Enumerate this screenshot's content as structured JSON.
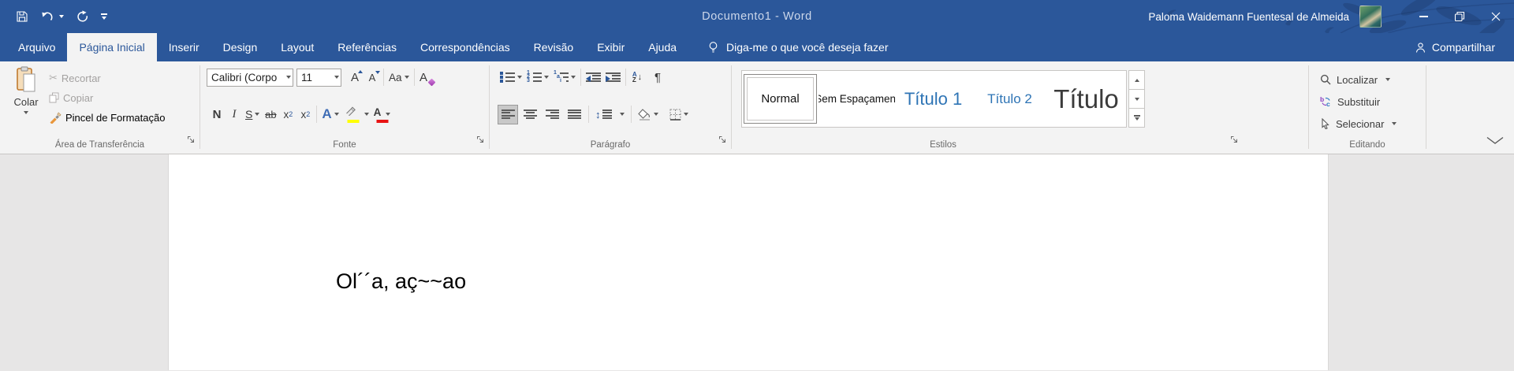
{
  "window": {
    "title": "Documento1  -  Word",
    "user_name": "Paloma Waidemann Fuentesal de Almeida"
  },
  "tabs": [
    {
      "label": "Arquivo",
      "selected": false
    },
    {
      "label": "Página Inicial",
      "selected": true
    },
    {
      "label": "Inserir",
      "selected": false
    },
    {
      "label": "Design",
      "selected": false
    },
    {
      "label": "Layout",
      "selected": false
    },
    {
      "label": "Referências",
      "selected": false
    },
    {
      "label": "Correspondências",
      "selected": false
    },
    {
      "label": "Revisão",
      "selected": false
    },
    {
      "label": "Exibir",
      "selected": false
    },
    {
      "label": "Ajuda",
      "selected": false
    }
  ],
  "tellme": {
    "label": "Diga-me o que você deseja fazer"
  },
  "share": {
    "label": "Compartilhar"
  },
  "ribbon": {
    "clipboard": {
      "group_label": "Área de Transferência",
      "paste_label": "Colar",
      "cut_label": "Recortar",
      "copy_label": "Copiar",
      "format_painter_label": "Pincel de Formatação"
    },
    "font": {
      "group_label": "Fonte",
      "font_name_value": "Calibri (Corpo",
      "font_size_value": "11",
      "bold_label": "N",
      "italic_label": "I",
      "underline_label": "S",
      "strikethrough_label": "ab",
      "subscript_base": "x",
      "subscript_digit": "2",
      "superscript_base": "x",
      "superscript_digit": "2",
      "grow_font_label": "A",
      "shrink_font_label": "A",
      "change_case_label": "Aa",
      "clear_format_label": "A",
      "text_effects_label": "A",
      "font_color_label": "A"
    },
    "paragraph": {
      "group_label": "Parágrafo",
      "sort_top": "A",
      "sort_bottom": "Z",
      "sort_arrow": "↓",
      "pilcrow": "¶",
      "line_spacing_arrows": "↕"
    },
    "styles": {
      "group_label": "Estilos",
      "items": [
        {
          "label": "Normal",
          "selected": true
        },
        {
          "label": "Sem Espaçament",
          "selected": false
        },
        {
          "label": "Título 1",
          "selected": false
        },
        {
          "label": "Título 2",
          "selected": false
        },
        {
          "label": "Título",
          "selected": false
        }
      ]
    },
    "editing": {
      "group_label": "Editando",
      "find_label": "Localizar",
      "replace_label": "Substituir",
      "select_label": "Selecionar"
    }
  },
  "document": {
    "text": "Ol´´a, aç~~ao"
  },
  "icons": {
    "save-icon": "floppy-outline",
    "undo-icon": "curved-arrow-left",
    "redo-icon": "circular-arrow",
    "customize-qat-icon": "bar-with-down-triangle",
    "minimize-icon": "horizontal-line",
    "restore-icon": "overlapping-squares",
    "close-icon": "x-cross",
    "lightbulb-icon": "bulb-outline",
    "person-icon": "person-outline",
    "paste-clipboard-icon": "orange-clipboard-white-sheet",
    "cut-icon": "scissors",
    "copy-icon": "two-sheets",
    "format-painter-icon": "orange-brush",
    "chevron-down-icon": "small-triangle-down",
    "dialog-launcher-icon": "corner-with-se-arrow",
    "search-icon": "magnifier",
    "replace-icon": "b-to-c-swap",
    "select-pointer-icon": "cursor-arrow",
    "collapse-ribbon-icon": "wide-chevron-down"
  },
  "colors": {
    "title_bar_blue": "#2b579a",
    "ribbon_bg": "#f3f3f3",
    "document_bg": "#e7e6e6",
    "heading_blue": "#2e74b5",
    "highlight_yellow": "#ffff00",
    "font_color_red": "#e81313",
    "disabled_gray": "#a3a1a0"
  }
}
